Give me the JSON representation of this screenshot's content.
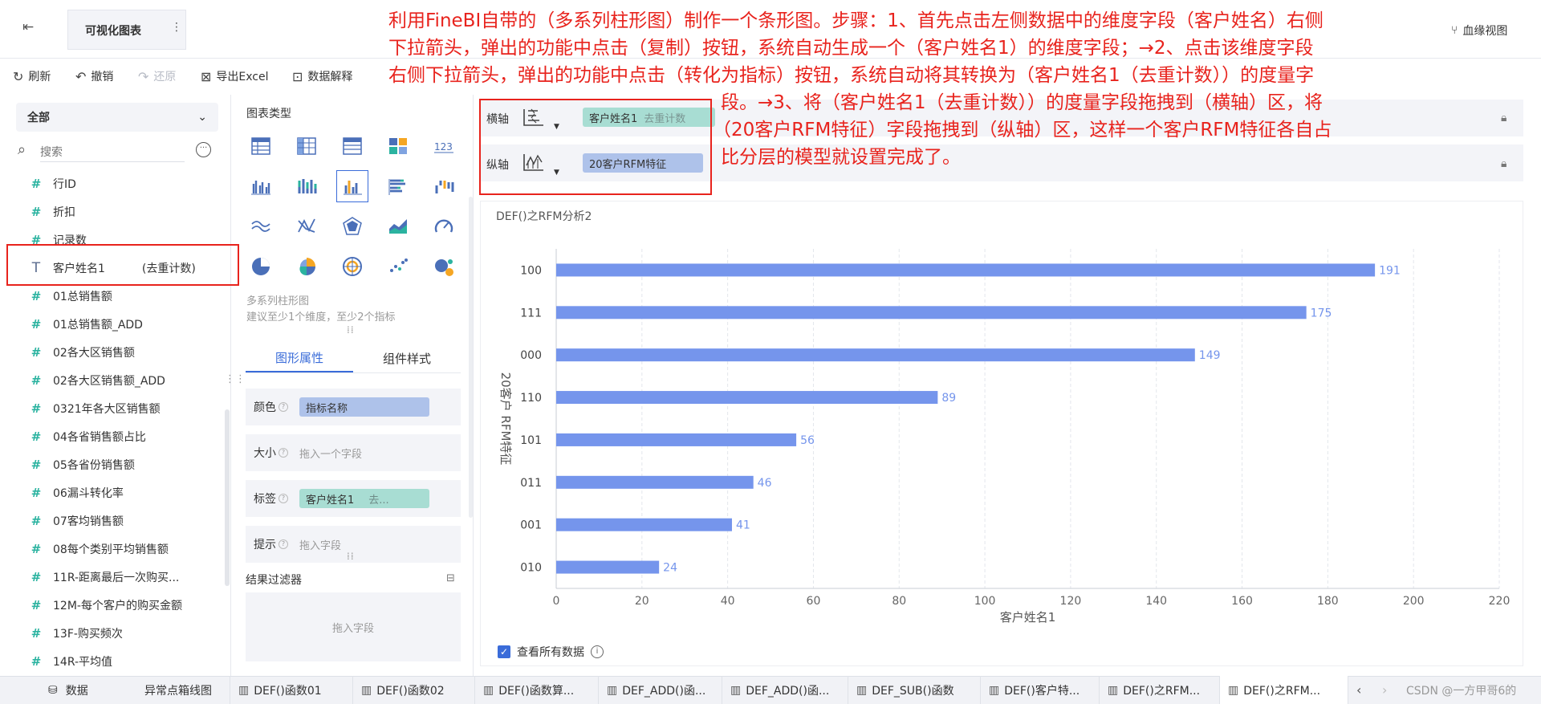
{
  "header": {
    "title": "可视化图表",
    "more_label": "⋮",
    "lineage_label": "血缘视图"
  },
  "toolbar": {
    "refresh": "刷新",
    "undo": "撤销",
    "redo": "还原",
    "export_excel": "导出Excel",
    "data_explain": "数据解释"
  },
  "left_panel": {
    "scope": "全部",
    "search_placeholder": "搜索",
    "fields": [
      {
        "icon": "#",
        "label": "行ID"
      },
      {
        "icon": "#",
        "label": "折扣"
      },
      {
        "icon": "#",
        "label": "记录数"
      },
      {
        "icon": "T",
        "label": "客户姓名1",
        "suffix": "(去重计数)"
      },
      {
        "icon": "#",
        "label": "01总销售额"
      },
      {
        "icon": "#",
        "label": "01总销售额_ADD"
      },
      {
        "icon": "#",
        "label": "02各大区销售额"
      },
      {
        "icon": "#",
        "label": "02各大区销售额_ADD"
      },
      {
        "icon": "#",
        "label": "0321年各大区销售额"
      },
      {
        "icon": "#",
        "label": "04各省销售额占比"
      },
      {
        "icon": "#",
        "label": "05各省份销售额"
      },
      {
        "icon": "#",
        "label": "06漏斗转化率"
      },
      {
        "icon": "#",
        "label": "07客均销售额"
      },
      {
        "icon": "#",
        "label": "08每个类别平均销售额"
      },
      {
        "icon": "#",
        "label": "11R-距离最后一次购买..."
      },
      {
        "icon": "#",
        "label": "12M-每个客户的购买金额"
      },
      {
        "icon": "#",
        "label": "13F-购买频次"
      },
      {
        "icon": "#",
        "label": "14R-平均值"
      }
    ]
  },
  "middle_panel": {
    "chart_type_label": "图表类型",
    "hint_title": "多系列柱形图",
    "hint_desc": "建议至少1个维度，至少2个指标",
    "tabs": [
      "图形属性",
      "组件样式"
    ],
    "props": [
      {
        "label": "颜色",
        "chip": "指标名称",
        "chip_style": "blue"
      },
      {
        "label": "大小",
        "placeholder": "拖入一个字段"
      },
      {
        "label": "标签",
        "chip": "客户姓名1",
        "chip_sub": "去...",
        "chip_style": "teal"
      },
      {
        "label": "提示",
        "placeholder": "拖入字段"
      }
    ],
    "filter_title": "结果过滤器",
    "filter_drop": "拖入字段"
  },
  "axes": {
    "x_label": "横轴",
    "x_chip": "客户姓名1",
    "x_chip_sub": "去重计数",
    "y_label": "纵轴",
    "y_chip": "20客户RFM特征"
  },
  "instruction": [
    "利用FineBI自带的（多系列柱形图）制作一个条形图。步骤：1、首先点击左侧数据中的维度字段（客户姓名）右侧",
    "下拉箭头，弹出的功能中点击（复制）按钮，系统自动生成一个（客户姓名1）的维度字段；→2、点击该维度字段",
    "右侧下拉箭头，弹出的功能中点击（转化为指标）按钮，系统自动将其转换为（客户姓名1（去重计数））的度量字",
    "段。→3、将（客户姓名1（去重计数））的度量字段拖拽到（横轴）区，将",
    "（20客户RFM特征）字段拖拽到（纵轴）区，这样一个客户RFM特征各自占",
    "比分层的模型就设置完成了。"
  ],
  "chart_data": {
    "type": "bar",
    "orientation": "horizontal",
    "title": "DEF()之RFM分析2",
    "categories": [
      "100",
      "111",
      "000",
      "110",
      "101",
      "011",
      "001",
      "010"
    ],
    "values": [
      191,
      175,
      149,
      89,
      56,
      46,
      41,
      24
    ],
    "xlabel": "客户姓名1",
    "ylabel": "20客户 RFM特征",
    "xlim": [
      0,
      220
    ],
    "xticks": [
      0,
      20,
      40,
      60,
      80,
      100,
      120,
      140,
      160,
      180,
      200,
      220
    ],
    "grid": true,
    "bar_color": "#7595ec",
    "label_color": "#7595ec"
  },
  "view_all_label": "查看所有数据",
  "bottom_bar": {
    "data_tab": "数据",
    "tabs": [
      "异常点箱线图",
      "DEF()函数01",
      "DEF()函数02",
      "DEF()函数算...",
      "DEF_ADD()函...",
      "DEF_ADD()函...",
      "DEF_SUB()函数",
      "DEF()客户特...",
      "DEF()之RFM...",
      "DEF()之RFM..."
    ],
    "watermark": "CSDN @一方甲哥6的"
  },
  "colors": {
    "accent": "#3a6cd9",
    "annotation_red": "#e8231d",
    "field_green": "#2bb3a0"
  }
}
